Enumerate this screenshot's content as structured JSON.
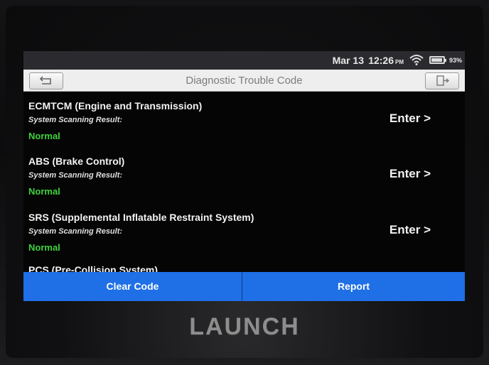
{
  "device": {
    "logo": "LAUNCH"
  },
  "status_bar": {
    "date": "Mar 13",
    "time": "12:26",
    "ampm": "PM",
    "battery_percent": "93%",
    "battery_level": 0.93
  },
  "title_bar": {
    "title": "Diagnostic Trouble Code"
  },
  "systems": [
    {
      "name": "ECMTCM (Engine and Transmission)",
      "result_label": "System Scanning Result:",
      "result": "Normal",
      "action": "Enter >"
    },
    {
      "name": "ABS (Brake Control)",
      "result_label": "System Scanning Result:",
      "result": "Normal",
      "action": "Enter >"
    },
    {
      "name": "SRS (Supplemental Inflatable Restraint System)",
      "result_label": "System Scanning Result:",
      "result": "Normal",
      "action": "Enter >"
    }
  ],
  "partial_item": "PCS (Pre-Collision System)",
  "actions": {
    "clear_code": "Clear Code",
    "report": "Report"
  },
  "colors": {
    "action_bar": "#1f6fe6",
    "normal_status": "#3fd23f",
    "title_bar": "#eeeeee"
  }
}
